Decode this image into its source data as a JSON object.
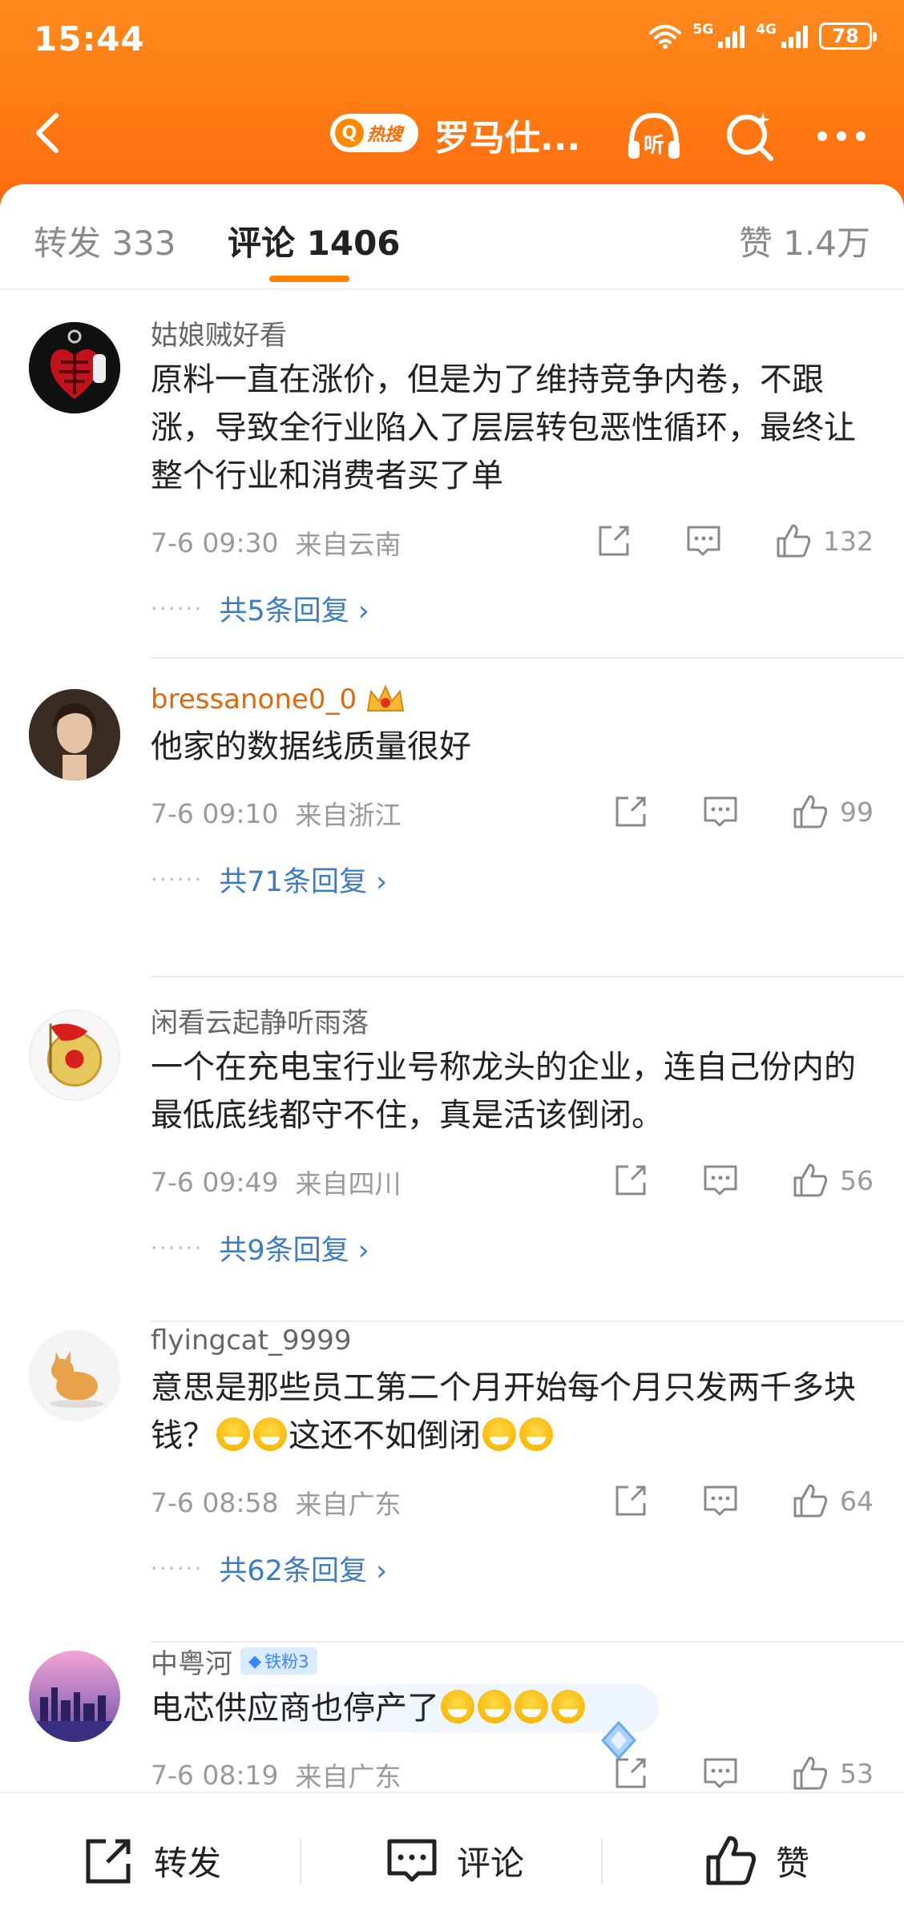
{
  "status_bar": {
    "time": "15:44",
    "network_5g": "5G",
    "network_4g": "4G",
    "battery": "78"
  },
  "nav": {
    "hot_label": "热搜",
    "title": "罗马仕..."
  },
  "tabs": {
    "repost": "转发 333",
    "comment": "评论 1406",
    "like": "赞 1.4万"
  },
  "comments": [
    {
      "user": "姑娘贼好看",
      "text": "原料一直在涨价，但是为了维持竞争内卷，不跟涨，导致全行业陷入了层层转包恶性循环，最终让整个行业和消费者买了单",
      "time": "7-6 09:30",
      "location": "来自云南",
      "likes": "132",
      "replies": "共5条回复 ›"
    },
    {
      "user": "bressanone0_0",
      "text": "他家的数据线质量很好",
      "time": "7-6 09:10",
      "location": "来自浙江",
      "likes": "99",
      "replies": "共71条回复 ›"
    },
    {
      "user": "闲看云起静听雨落",
      "text": "一个在充电宝行业号称龙头的企业，连自己份内的最低底线都守不住，真是活该倒闭。",
      "time": "7-6 09:49",
      "location": "来自四川",
      "likes": "56",
      "replies": "共9条回复 ›"
    },
    {
      "user": "flyingcat_9999",
      "text_a": "意思是那些员工第二个月开始每个月只发两千多块钱？",
      "text_b": "这还不如倒闭",
      "time": "7-6 08:58",
      "location": "来自广东",
      "likes": "64",
      "replies": "共62条回复 ›"
    },
    {
      "user": "中粤河",
      "badge": "铁粉3",
      "text": "电芯供应商也停产了",
      "time": "7-6 08:19",
      "location": "来自广东",
      "likes": "53"
    }
  ],
  "colors": {
    "header": "#ff7a12",
    "accent": "#ff8200",
    "link": "#3b7cc4",
    "vip_name": "#e06a0a"
  },
  "bottom_bar": {
    "repost": "转发",
    "comment": "评论",
    "like": "赞"
  }
}
